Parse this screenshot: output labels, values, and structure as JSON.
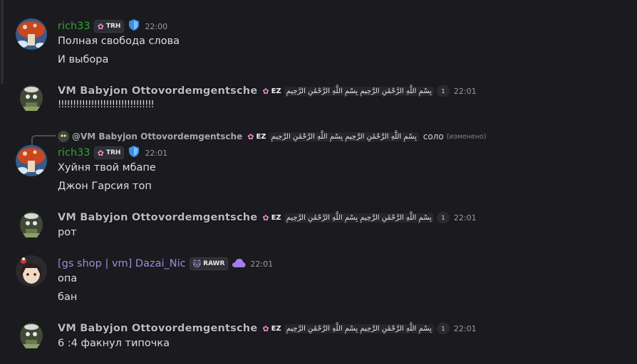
{
  "messages": [
    {
      "username": "rich33",
      "badge_text": "TRH",
      "badge_icon": "flower-icon",
      "extra_icon": "shield-icon",
      "time": "22:00",
      "lines": [
        "Полная свобода слова",
        "И выбора"
      ]
    },
    {
      "username": "VM Babyjon Ottovordemgentsche",
      "badge_text": "EZ",
      "badge_icon": "flower-icon",
      "arabic": "بِسْمِ اللَّهِ الرَّحْمَٰنِ الرَّحِيمِ بِسْمِ اللَّهِ الرَّحْمَٰنِ الرَّحِيمِ",
      "small_badge": "1",
      "time": "22:01",
      "lines": [
        "!!!!!!!!!!!!!!!!!!!!!!!!!!!!!!!!"
      ]
    },
    {
      "reply": {
        "username": "@VM Babyjon Ottovordemgentsche",
        "badge_text": "EZ",
        "arabic": "بِسْمِ اللَّهِ الرَّحْمَٰنِ الرَّحِيمِ بِسْمِ اللَّهِ الرَّحْمَٰنِ الرَّحِيمِ",
        "text": "соло",
        "edited": "(изменено)"
      },
      "username": "rich33",
      "badge_text": "TRH",
      "badge_icon": "flower-icon",
      "extra_icon": "shield-icon",
      "time": "22:01",
      "lines": [
        "Хуйня твой мбапе",
        "Джон Гарсия топ"
      ]
    },
    {
      "username": "VM Babyjon Ottovordemgentsche",
      "badge_text": "EZ",
      "badge_icon": "flower-icon",
      "arabic": "بِسْمِ اللَّهِ الرَّحْمَٰنِ الرَّحِيمِ بِسْمِ اللَّهِ الرَّحْمَٰنِ الرَّحِيمِ",
      "small_badge": "1",
      "time": "22:01",
      "lines": [
        "рот"
      ]
    },
    {
      "username": "[gs shop | vm] Dazai_Nic",
      "badge_text": "RAWR",
      "badge_icon": "cat-icon",
      "extra_icon": "cloud-icon",
      "time": "22:01",
      "lines": [
        "опа",
        "бан"
      ]
    },
    {
      "username": "VM Babyjon Ottovordemgentsche",
      "badge_text": "EZ",
      "badge_icon": "flower-icon",
      "arabic": "بِسْمِ اللَّهِ الرَّحْمَٰنِ الرَّحِيمِ بِسْمِ اللَّهِ الرَّحْمَٰنِ الرَّحِيمِ",
      "small_badge": "1",
      "time": "22:01",
      "lines": [
        "6 :4 факнул типочка"
      ]
    }
  ],
  "colors": {
    "background": "#1b1b1f",
    "rich33_name": "#2fa331",
    "vm_name": "#b9bbbe",
    "dazai_name": "#9d8cd6",
    "timestamp": "#949ba4",
    "text": "#dbdee1"
  }
}
